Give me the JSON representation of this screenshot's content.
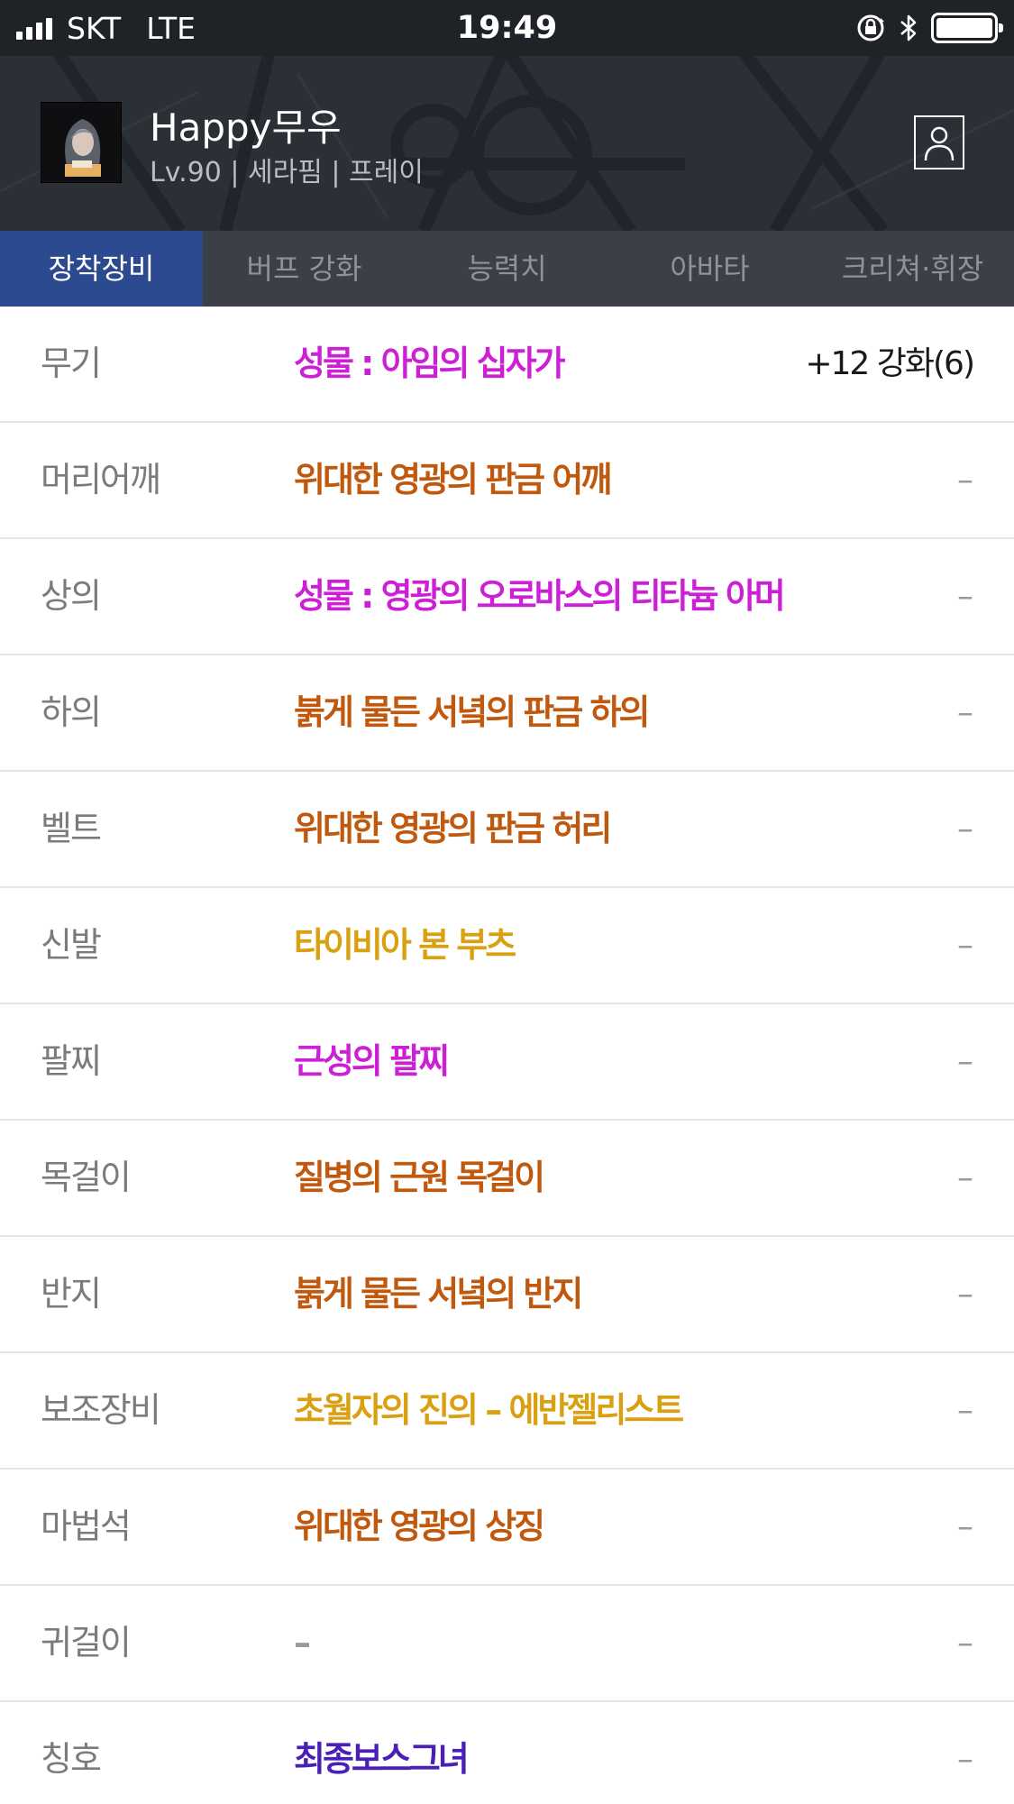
{
  "status_bar": {
    "carrier": "SKT",
    "network": "LTE",
    "time": "19:49"
  },
  "profile": {
    "name": "Happy무우",
    "info": "Lv.90 | 세라핌 | 프레이",
    "profile_icon": "user-card-icon"
  },
  "tabs": [
    {
      "label": "장착장비",
      "active": true
    },
    {
      "label": "버프 강화",
      "active": false
    },
    {
      "label": "능력치",
      "active": false
    },
    {
      "label": "아바타",
      "active": false
    },
    {
      "label": "크리쳐·휘장",
      "active": false
    }
  ],
  "equipment": [
    {
      "slot": "무기",
      "item": "성물 : 아임의 십자가",
      "enhance": "+12 강화(6)",
      "color": "#cc1fd6"
    },
    {
      "slot": "머리어깨",
      "item": "위대한 영광의 판금 어깨",
      "enhance": "–",
      "color": "#c0580e"
    },
    {
      "slot": "상의",
      "item": "성물 : 영광의 오로바스의 티타늄 아머",
      "enhance": "–",
      "color": "#cc1fd6"
    },
    {
      "slot": "하의",
      "item": "붉게 물든 서녘의 판금 하의",
      "enhance": "–",
      "color": "#c0580e"
    },
    {
      "slot": "벨트",
      "item": "위대한 영광의 판금 허리",
      "enhance": "–",
      "color": "#c0580e"
    },
    {
      "slot": "신발",
      "item": "타이비아 본 부츠",
      "enhance": "–",
      "color": "#d9a010"
    },
    {
      "slot": "팔찌",
      "item": "근성의 팔찌",
      "enhance": "–",
      "color": "#cc1fd6"
    },
    {
      "slot": "목걸이",
      "item": "질병의 근원 목걸이",
      "enhance": "–",
      "color": "#c0580e"
    },
    {
      "slot": "반지",
      "item": "붉게 물든 서녘의 반지",
      "enhance": "–",
      "color": "#c0580e"
    },
    {
      "slot": "보조장비",
      "item": "초월자의 진의 – 에반젤리스트",
      "enhance": "–",
      "color": "#d9a010"
    },
    {
      "slot": "마법석",
      "item": "위대한 영광의 상징",
      "enhance": "–",
      "color": "#c0580e"
    },
    {
      "slot": "귀걸이",
      "item": "–",
      "enhance": "–",
      "color": "#9a9a9a"
    },
    {
      "slot": "칭호",
      "item": "최종보스그녀",
      "enhance": "–",
      "color": "#4a1fb8"
    }
  ]
}
